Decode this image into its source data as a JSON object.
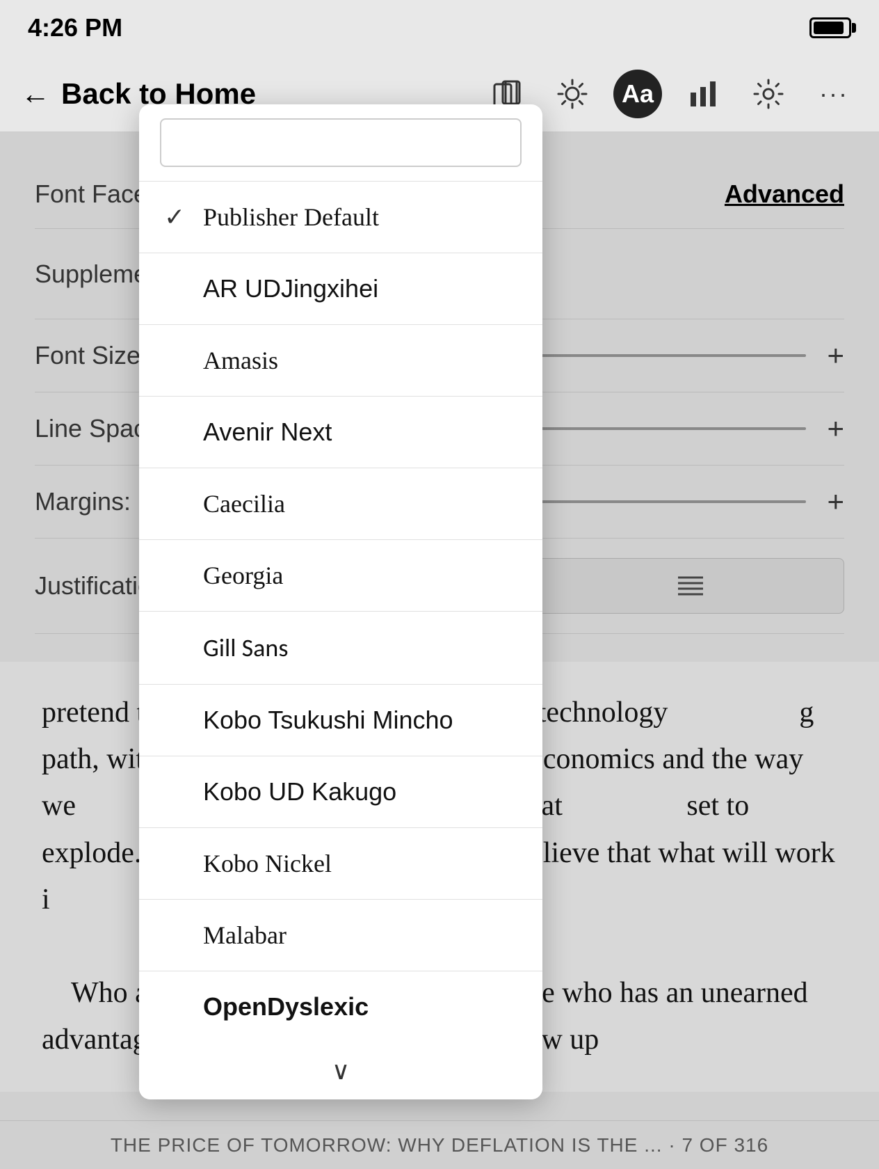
{
  "statusBar": {
    "time": "4:26 PM"
  },
  "navBar": {
    "backLabel": "Back to Home",
    "icons": {
      "orientation": "⬜",
      "brightness": "☀",
      "font": "Aa",
      "stats": "📊",
      "settings": "⚙",
      "more": "···"
    }
  },
  "settings": {
    "fontFaceLabel": "Font Face:",
    "advancedLabel": "Advanced",
    "supplementalLabel": "Supplemental",
    "fontSizeLabel": "Font Size:",
    "lineSpacingLabel": "Line Spacing:",
    "marginsLabel": "Margins:",
    "justificationLabel": "Justification:"
  },
  "fontDropdown": {
    "items": [
      {
        "name": "Publisher Default",
        "checked": true,
        "class": "publisher-default"
      },
      {
        "name": "AR UDJingxihei",
        "checked": false,
        "class": "ar-ud"
      },
      {
        "name": "Amasis",
        "checked": false,
        "class": "amasis"
      },
      {
        "name": "Avenir Next",
        "checked": false,
        "class": "avenir"
      },
      {
        "name": "Caecilia",
        "checked": false,
        "class": "caecilia"
      },
      {
        "name": "Georgia",
        "checked": false,
        "class": "georgia"
      },
      {
        "name": "Gill Sans",
        "checked": false,
        "class": "gill-sans"
      },
      {
        "name": "Kobo Tsukushi Mincho",
        "checked": false,
        "class": "kobo-tsukushi"
      },
      {
        "name": "Kobo UD Kakugo",
        "checked": false,
        "class": "kobo-ud"
      },
      {
        "name": "Kobo Nickel",
        "checked": false,
        "class": "kobo-nickel"
      },
      {
        "name": "Malabar",
        "checked": false,
        "class": "malabar"
      },
      {
        "name": "OpenDyslexic",
        "checked": false,
        "class": "open-dyslexic"
      }
    ],
    "moreChevron": "∨"
  },
  "readingContent": {
    "paragraph1": "pretend the                      did in an era before technology                      g path, without significant                   k about economics and the way we                  es will ensure chaos. On this pat                   set to explode. In this extraordina                  e to believe that what will work i                  rily be built on what worked in",
    "paragraph2": "Who am I to be saying this? I'm someone who has an unearned advantage and wants to use it to help. I grew up"
  },
  "bookFooter": {
    "text": "THE PRICE OF TOMORROW: WHY DEFLATION IS THE ... · 7 OF 316"
  }
}
